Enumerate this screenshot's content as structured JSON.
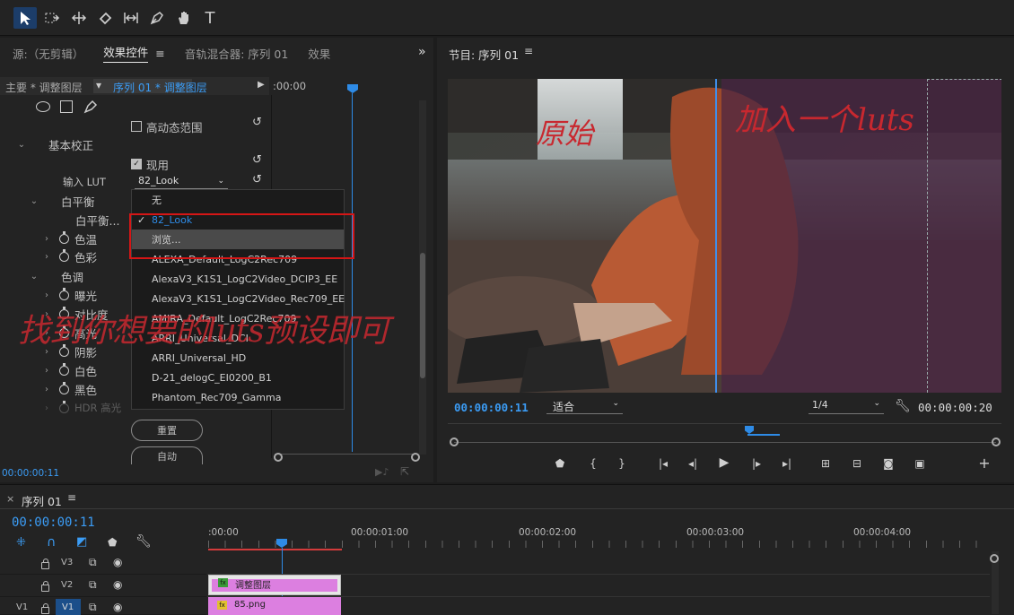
{
  "toolbar": {
    "tools": [
      "selection-tool",
      "track-select-tool",
      "ripple-edit-tool",
      "razor-tool",
      "slip-tool",
      "pen-tool",
      "hand-tool",
      "type-tool"
    ]
  },
  "left_panel": {
    "tabs": {
      "source": "源:（无剪辑）",
      "effect_controls": "效果控件",
      "audio_mixer": "音轨混合器: 序列 01",
      "effects": "效果"
    },
    "master_label": "主要 * 调整图层",
    "clip_label": "序列 01 * 调整图层",
    "timecode_ruler": ":00:00",
    "hdr_range": "高动态范围",
    "basic_correction": "基本校正",
    "enable": "现用",
    "input_lut_label": "输入 LUT",
    "input_lut_value": "82_Look",
    "white_balance": "白平衡",
    "white_balance_selector": "白平衡...",
    "temperature": "色温",
    "tint": "色彩",
    "tone": "色调",
    "exposure": "曝光",
    "contrast": "对比度",
    "highlights": "高光",
    "shadows": "阴影",
    "whites": "白色",
    "blacks": "黑色",
    "hdr_highlights": "HDR 高光",
    "reset_btn": "重置",
    "auto_btn": "自动",
    "timecode": "00:00:00:11"
  },
  "lut_menu": {
    "items": [
      "无",
      "82_Look",
      "浏览...",
      "ALEXA_Default_LogC2Rec709",
      "AlexaV3_K1S1_LogC2Video_DCIP3_EE",
      "AlexaV3_K1S1_LogC2Video_Rec709_EE",
      "AMIRA_Default_LogC2Rec709",
      "ARRI_Universal_DCI",
      "ARRI_Universal_HD",
      "D-21_delogC_EI0200_B1",
      "Phantom_Rec709_Gamma"
    ]
  },
  "annotations": {
    "original": "原始",
    "added": "加入一个luts",
    "find": "找到你想要的luts预设即可"
  },
  "program": {
    "title": "节目: 序列 01",
    "timecode": "00:00:00:11",
    "fit": "适合",
    "resolution": "1/4",
    "duration": "00:00:00:20"
  },
  "timeline": {
    "title": "序列 01",
    "timecode": "00:00:00:11",
    "ruler": [
      ":00:00",
      "00:00:01:00",
      "00:00:02:00",
      "00:00:03:00",
      "00:00:04:00"
    ],
    "tracks": [
      {
        "name": "V3",
        "src": ""
      },
      {
        "name": "V2",
        "src": ""
      },
      {
        "name": "V1",
        "src": "V1"
      }
    ],
    "clips": {
      "adjust": "调整图层",
      "png": "85.png",
      "fx": "fx"
    }
  }
}
